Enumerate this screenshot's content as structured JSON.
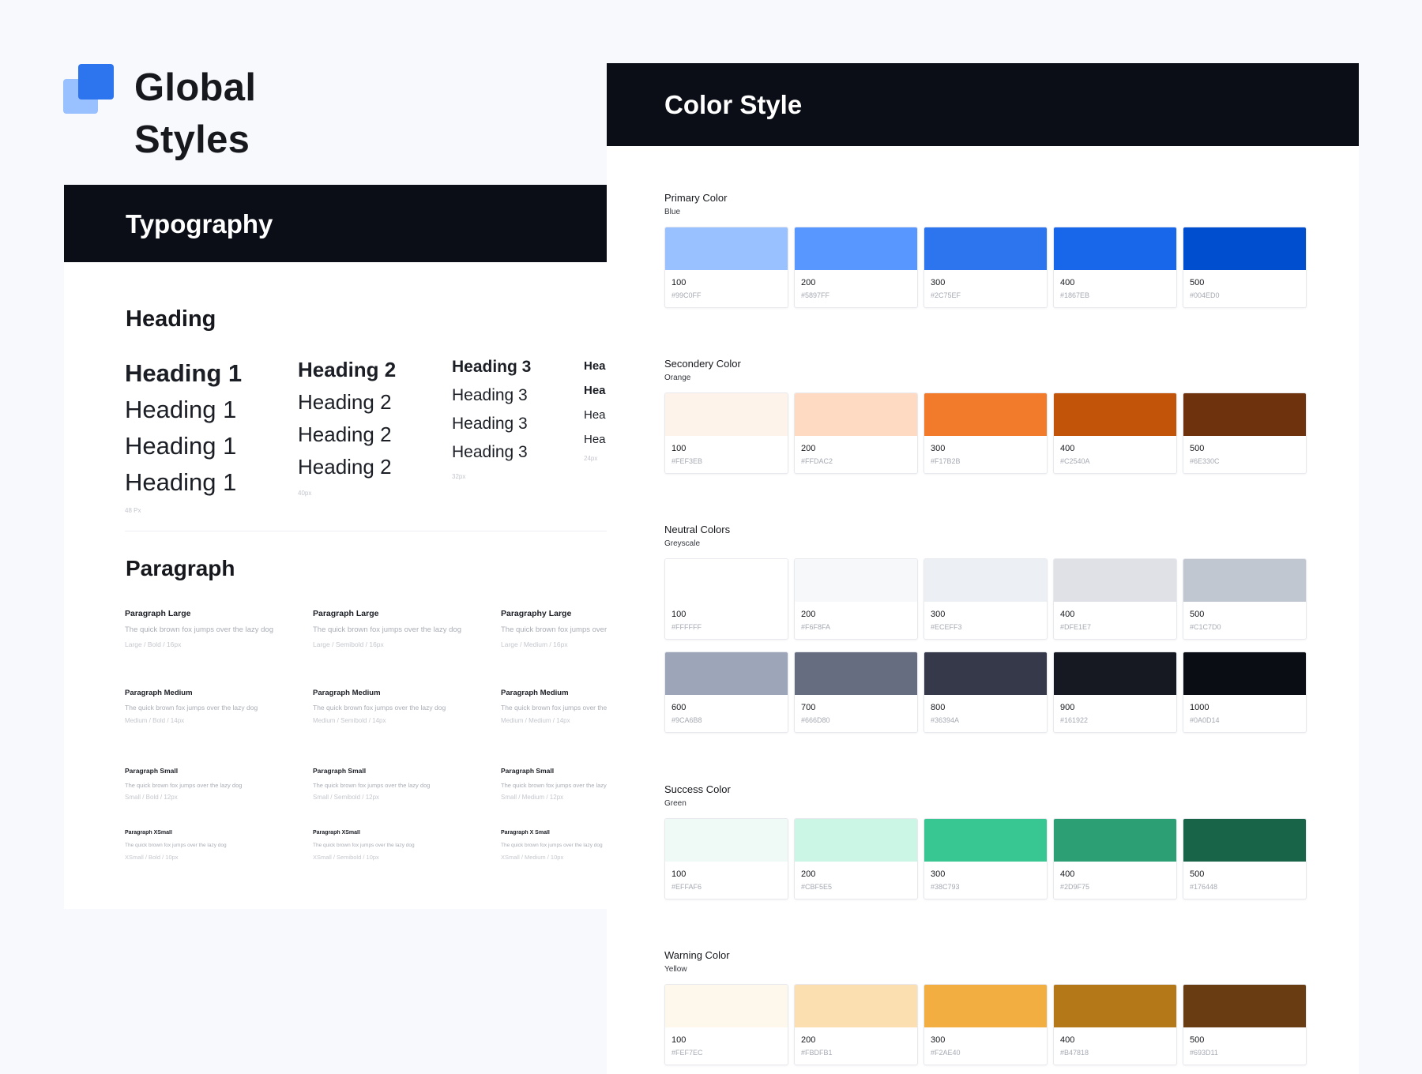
{
  "brand": {
    "title": "Global Styles"
  },
  "typography": {
    "title": "Typography",
    "heading_section": "Heading",
    "heading_columns": [
      {
        "lines": [
          "Heading 1",
          "Heading 1",
          "Heading 1",
          "Heading 1"
        ],
        "size": "48 Px"
      },
      {
        "lines": [
          "Heading 2",
          "Heading 2",
          "Heading 2",
          "Heading 2"
        ],
        "size": "40px"
      },
      {
        "lines": [
          "Heading 3",
          "Heading 3",
          "Heading 3",
          "Heading 3"
        ],
        "size": "32px"
      },
      {
        "lines": [
          "Hea",
          "Hea",
          "Hea",
          "Hea"
        ],
        "size": "24px"
      }
    ],
    "paragraph_section": "Paragraph",
    "paragraph_columns": [
      {
        "blocks": [
          {
            "name": "Paragraph Large",
            "text": "The quick brown fox jumps over the lazy dog",
            "meta": "Large / Bold / 16px"
          },
          {
            "name": "Paragraph Medium",
            "text": "The quick brown fox jumps over the lazy dog",
            "meta": "Medium / Bold / 14px"
          },
          {
            "name": "Paragraph Small",
            "text": "The quick brown fox jumps over the lazy dog",
            "meta": "Small / Bold / 12px"
          },
          {
            "name": "Paragraph XSmall",
            "text": "The quick brown fox jumps over the lazy dog",
            "meta": "XSmall / Bold / 10px"
          }
        ]
      },
      {
        "blocks": [
          {
            "name": "Paragraph Large",
            "text": "The quick brown fox jumps over the lazy dog",
            "meta": "Large / Semibold / 16px"
          },
          {
            "name": "Paragraph Medium",
            "text": "The quick brown fox jumps over the lazy dog",
            "meta": "Medium / Semibold / 14px"
          },
          {
            "name": "Paragraph Small",
            "text": "The quick brown fox jumps over the lazy dog",
            "meta": "Small / Semibold / 12px"
          },
          {
            "name": "Paragraph XSmall",
            "text": "The quick brown fox jumps over the lazy dog",
            "meta": "XSmall / Semibold / 10px"
          }
        ]
      },
      {
        "blocks": [
          {
            "name": "Paragraphy Large",
            "text": "The quick brown fox jumps over the lazy dog",
            "meta": "Large / Medium / 16px"
          },
          {
            "name": "Paragraph Medium",
            "text": "The quick brown fox jumps over the dog",
            "meta": "Medium / Medium / 14px"
          },
          {
            "name": "Paragraph Small",
            "text": "The quick brown fox jumps over the lazy dog",
            "meta": "Small / Medium / 12px"
          },
          {
            "name": "Paragraph X Small",
            "text": "The quick brown fox jumps over the lazy dog",
            "meta": "XSmall / Medium / 10px"
          }
        ]
      }
    ]
  },
  "colors": {
    "title": "Color Style",
    "groups": [
      {
        "title": "Primary Color",
        "subtitle": "Blue",
        "swatches": [
          {
            "name": "100",
            "hex": "#99C0FF"
          },
          {
            "name": "200",
            "hex": "#5897FF"
          },
          {
            "name": "300",
            "hex": "#2C75EF"
          },
          {
            "name": "400",
            "hex": "#1867EB"
          },
          {
            "name": "500",
            "hex": "#004ED0"
          }
        ]
      },
      {
        "title": "Secondery Color",
        "subtitle": "Orange",
        "swatches": [
          {
            "name": "100",
            "hex": "#FEF3EB"
          },
          {
            "name": "200",
            "hex": "#FFDAC2"
          },
          {
            "name": "300",
            "hex": "#F17B2B"
          },
          {
            "name": "400",
            "hex": "#C2540A"
          },
          {
            "name": "500",
            "hex": "#6E330C"
          }
        ]
      },
      {
        "title": "Neutral Colors",
        "subtitle": "Greyscale",
        "swatches": [
          {
            "name": "100",
            "hex": "#FFFFFF"
          },
          {
            "name": "200",
            "hex": "#F6F8FA"
          },
          {
            "name": "300",
            "hex": "#ECEFF3"
          },
          {
            "name": "400",
            "hex": "#DFE1E7"
          },
          {
            "name": "500",
            "hex": "#C1C7D0"
          },
          {
            "name": "600",
            "hex": "#9CA6B8"
          },
          {
            "name": "700",
            "hex": "#666D80"
          },
          {
            "name": "800",
            "hex": "#36394A"
          },
          {
            "name": "900",
            "hex": "#161922"
          },
          {
            "name": "1000",
            "hex": "#0A0D14"
          }
        ]
      },
      {
        "title": "Success Color",
        "subtitle": "Green",
        "swatches": [
          {
            "name": "100",
            "hex": "#EFFAF6"
          },
          {
            "name": "200",
            "hex": "#CBF5E5"
          },
          {
            "name": "300",
            "hex": "#38C793"
          },
          {
            "name": "400",
            "hex": "#2D9F75"
          },
          {
            "name": "500",
            "hex": "#176448"
          }
        ]
      },
      {
        "title": "Warning Color",
        "subtitle": "Yellow",
        "swatches": [
          {
            "name": "100",
            "hex": "#FEF7EC"
          },
          {
            "name": "200",
            "hex": "#FBDFB1"
          },
          {
            "name": "300",
            "hex": "#F2AE40"
          },
          {
            "name": "400",
            "hex": "#B47818"
          },
          {
            "name": "500",
            "hex": "#693D11"
          }
        ]
      }
    ]
  },
  "theme": {
    "header_bg": "#0B0E16",
    "page_bg": "#F8F9FD",
    "logo_front": "#2C75EF",
    "logo_back": "#99C0FF",
    "logo_icon": "layers-logo-icon"
  }
}
